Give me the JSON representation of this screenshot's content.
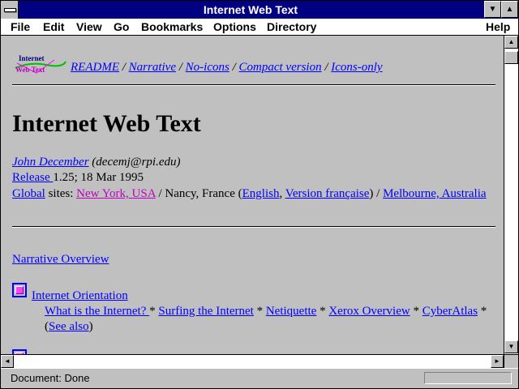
{
  "window": {
    "title": "Internet Web Text"
  },
  "menu": {
    "file": "File",
    "edit": "Edit",
    "view": "View",
    "go": "Go",
    "bookmarks": "Bookmarks",
    "options": "Options",
    "directory": "Directory",
    "help": "Help"
  },
  "logo": {
    "line1": "Internet",
    "line2": "Web Text"
  },
  "nav": {
    "readme": "README",
    "narrative": "Narrative",
    "no_icons": "No-icons",
    "compact": "Compact version",
    "icons_only": "Icons-only",
    "sep": " / "
  },
  "page": {
    "heading": "Internet Web Text",
    "author_name": "John December",
    "author_email": " (decemj@rpi.edu)",
    "release_label": "Release ",
    "release_info": " 1.25; 18 Mar 1995",
    "global_label": "Global",
    "sites_text": " sites: ",
    "ny_link": "New York, USA",
    "nancy_text": " / Nancy, France (",
    "english_link": "English",
    "comma": ", ",
    "french_link": "Version française",
    "close_paren": ") / ",
    "melbourne_link": "Melbourne, Australia",
    "narrative_overview": "Narrative Overview",
    "orientation": "Internet Orientation",
    "what_is": "What is the Internet? ",
    "surfing": "Surfing the Internet",
    "netiquette": "Netiquette",
    "xerox": "Xerox Overview",
    "cyberatlas": "CyberAtlas",
    "star": " * ",
    "open_paren": "(",
    "see_also": "See also",
    "close_paren2": ")"
  },
  "status": {
    "text": "Document: Done"
  },
  "colors": {
    "link": "#0000ff",
    "visited": "#c000c0",
    "titlebar": "#000080",
    "chrome": "#c0c0c0"
  }
}
